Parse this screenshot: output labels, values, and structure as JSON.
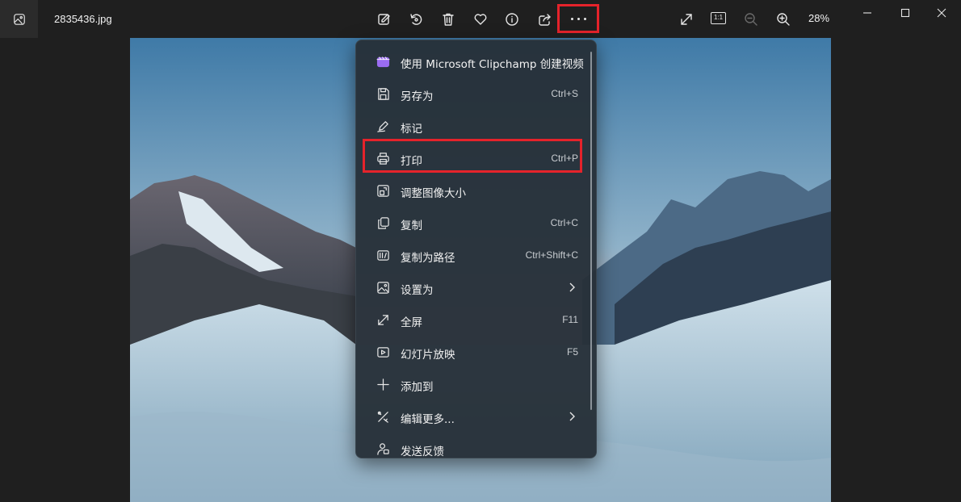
{
  "titlebar": {
    "file_name": "2835436.jpg",
    "zoom_level": "28%",
    "one_to_one_label": "1:1",
    "actions": [
      {
        "icon": "edit-image-icon"
      },
      {
        "icon": "rotate-icon"
      },
      {
        "icon": "delete-icon"
      },
      {
        "icon": "favorite-heart-icon"
      },
      {
        "icon": "info-icon"
      },
      {
        "icon": "share-icon"
      },
      {
        "icon": "more-options-icon"
      }
    ]
  },
  "menu": {
    "items": [
      {
        "label": "使用 Microsoft Clipchamp 创建视频",
        "shortcut": "",
        "icon": "clipchamp-icon"
      },
      {
        "label": "另存为",
        "shortcut": "Ctrl+S",
        "icon": "save-icon"
      },
      {
        "label": "标记",
        "shortcut": "",
        "icon": "markup-pen-icon"
      },
      {
        "label": "打印",
        "shortcut": "Ctrl+P",
        "icon": "print-icon"
      },
      {
        "label": "调整图像大小",
        "shortcut": "",
        "icon": "resize-image-icon"
      },
      {
        "label": "复制",
        "shortcut": "Ctrl+C",
        "icon": "copy-icon"
      },
      {
        "label": "复制为路径",
        "shortcut": "Ctrl+Shift+C",
        "icon": "copy-path-icon"
      },
      {
        "label": "设置为",
        "shortcut": "",
        "icon": "set-as-icon"
      },
      {
        "label": "全屏",
        "shortcut": "F11",
        "icon": "fullscreen-icon"
      },
      {
        "label": "幻灯片放映",
        "shortcut": "F5",
        "icon": "slideshow-icon"
      },
      {
        "label": "添加到",
        "shortcut": "",
        "icon": "add-icon"
      },
      {
        "label": "编辑更多...",
        "shortcut": "",
        "icon": "edit-more-icon"
      },
      {
        "label": "发送反馈",
        "shortcut": "",
        "icon": "feedback-icon"
      }
    ]
  },
  "colors": {
    "highlight_box": "#e5232b",
    "menu_background": "#263038",
    "titlebar_background": "#1f1f1f"
  }
}
